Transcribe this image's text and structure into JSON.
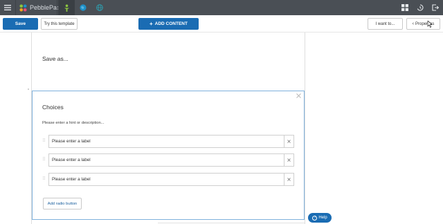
{
  "app": {
    "brand_name": "PebblePad"
  },
  "toolbar": {
    "save_label": "Save",
    "try_label": "Try this template",
    "add_content_label": "ADD CONTENT",
    "i_want_label": "I want to...",
    "properties_label": "Properties"
  },
  "page": {
    "save_as_title": "Save as..."
  },
  "choices": {
    "title": "Choices",
    "hint": "Please enter a hint or description...",
    "options": [
      {
        "label": "Please enter a label"
      },
      {
        "label": "Please enter a label"
      },
      {
        "label": "Please enter a label"
      }
    ],
    "add_button_label": "Add radio button"
  },
  "help": {
    "label": "Help",
    "icon_glyph": "?"
  },
  "colors": {
    "topbar": "#4a4f55",
    "primary": "#1a6cb3",
    "card_border": "#7fb1dc",
    "tab_green": "#8cc63f",
    "tab_blue": "#1e90c8",
    "tab_teal": "#2ba6b8"
  }
}
